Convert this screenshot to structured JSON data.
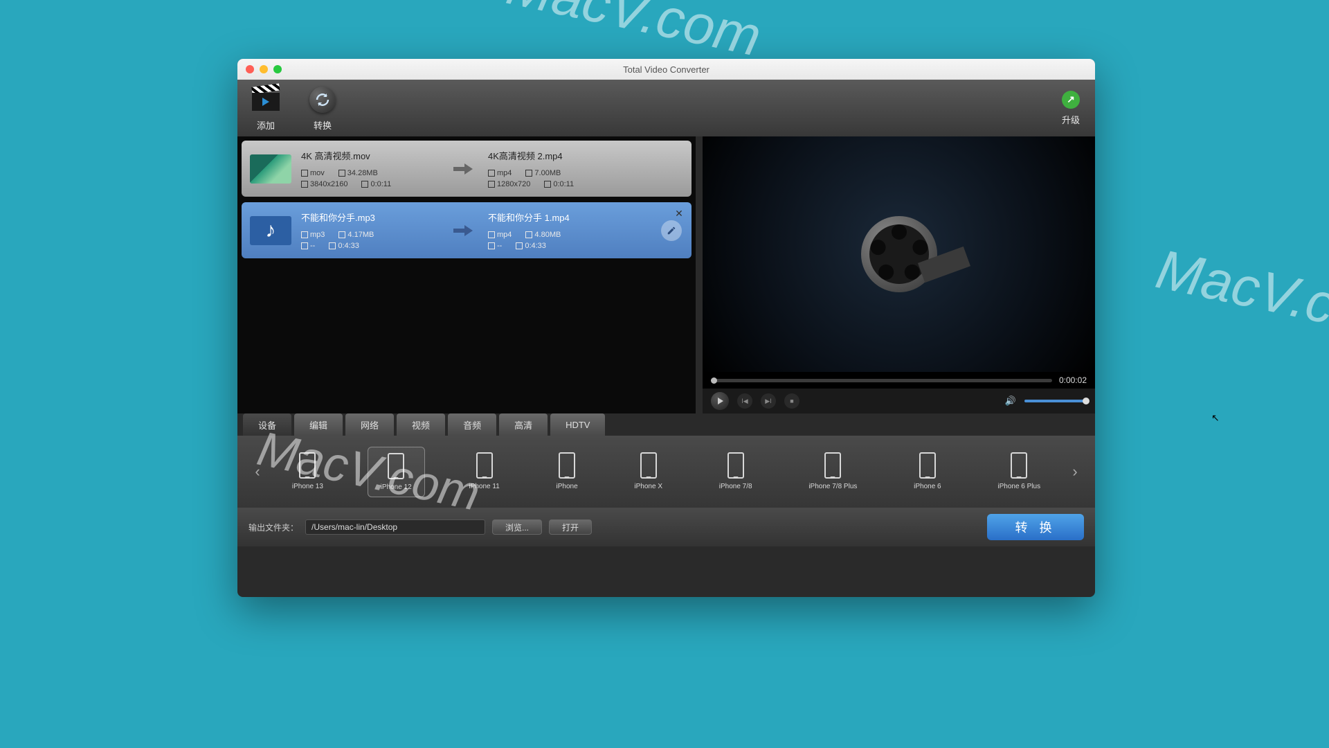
{
  "window": {
    "title": "Total Video Converter"
  },
  "toolbar": {
    "add": "添加",
    "convert": "转换",
    "upgrade": "升级"
  },
  "items": [
    {
      "src": {
        "name": "4K 高清视频.mov",
        "fmt": "mov",
        "size": "34.28MB",
        "res": "3840x2160",
        "dur": "0:0:11"
      },
      "dst": {
        "name": "4K高清视频 2.mp4",
        "fmt": "mp4",
        "size": "7.00MB",
        "res": "1280x720",
        "dur": "0:0:11"
      }
    },
    {
      "src": {
        "name": "不能和你分手.mp3",
        "fmt": "mp3",
        "size": "4.17MB",
        "res": "--",
        "dur": "0:4:33"
      },
      "dst": {
        "name": "不能和你分手 1.mp4",
        "fmt": "mp4",
        "size": "4.80MB",
        "res": "--",
        "dur": "0:4:33"
      }
    }
  ],
  "preview": {
    "time": "0:00:02"
  },
  "tabs": [
    "设备",
    "编辑",
    "网络",
    "视频",
    "音频",
    "高清",
    "HDTV"
  ],
  "devices": [
    "iPhone 13",
    "iPhone 12",
    "iPhone 11",
    "iPhone",
    "iPhone X",
    "iPhone 7/8",
    "iPhone 7/8 Plus",
    "iPhone 6",
    "iPhone 6 Plus"
  ],
  "bottom": {
    "outputLabel": "输出文件夹：",
    "path": "/Users/mac-lin/Desktop",
    "browse": "浏览...",
    "open": "打开",
    "convert": "转 换"
  },
  "watermark": "MacV.com"
}
